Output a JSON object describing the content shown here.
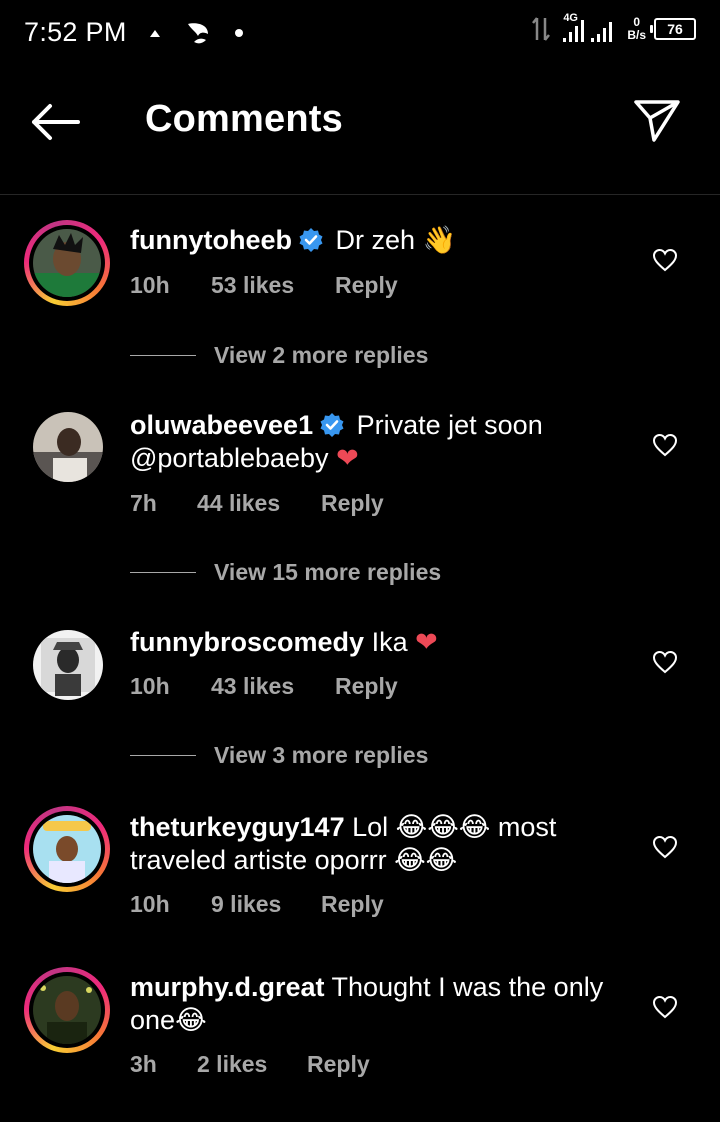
{
  "status_bar": {
    "time": "7:52 PM",
    "network": "4G",
    "speed_value": "0",
    "speed_unit": "B/s",
    "battery": "76"
  },
  "header": {
    "title": "Comments"
  },
  "comments": [
    {
      "username": "funnytoheeb",
      "verified": true,
      "text": "Dr zeh",
      "emoji": "👋",
      "time": "10h",
      "likes": "53 likes",
      "reply": "Reply",
      "view_replies": "View 2 more replies"
    },
    {
      "username": "oluwabeevee1",
      "verified": true,
      "text": "Private jet soon",
      "text_line2": "@portablebaeby",
      "emoji": "❤",
      "time": "7h",
      "likes": "44 likes",
      "reply": "Reply",
      "view_replies": "View 15 more replies"
    },
    {
      "username": "funnybroscomedy",
      "verified": false,
      "text": "Ika",
      "emoji": "❤",
      "time": "10h",
      "likes": "43 likes",
      "reply": "Reply",
      "view_replies": "View 3 more replies"
    },
    {
      "username": "theturkeyguy147",
      "verified": false,
      "text": "Lol",
      "emoji": "😂😂😂",
      "text_after": "most",
      "text_line2": "traveled artiste oporrr",
      "emoji_line2": "😂😂",
      "time": "10h",
      "likes": "9 likes",
      "reply": "Reply"
    },
    {
      "username": "murphy.d.great",
      "verified": false,
      "text": "Thought I was the only",
      "text_line2": "one",
      "emoji_line2": "😂",
      "time": "3h",
      "likes": "2 likes",
      "reply": "Reply"
    }
  ],
  "icons": {
    "back": "arrow-left-icon",
    "send": "paper-plane-icon",
    "like": "heart-outline-icon",
    "verified": "verified-badge-icon"
  },
  "colors": {
    "background": "#000000",
    "secondary_text": "#a8a8a8",
    "verified_blue": "#3897f0",
    "heart_red": "#ed4956"
  }
}
